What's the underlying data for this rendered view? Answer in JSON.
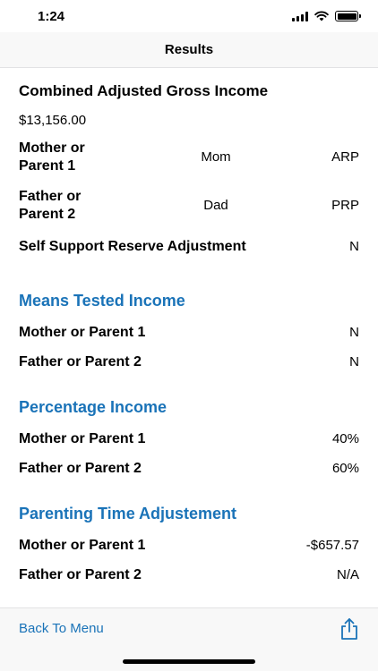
{
  "status": {
    "time": "1:24"
  },
  "nav": {
    "title": "Results"
  },
  "combined": {
    "title": "Combined Adjusted Gross Income",
    "amount": "$13,156.00"
  },
  "parents": [
    {
      "label": "Mother or Parent 1",
      "short": "Mom",
      "code": "ARP"
    },
    {
      "label": "Father or Parent 2",
      "short": "Dad",
      "code": "PRP"
    }
  ],
  "ssr": {
    "label": "Self Support Reserve Adjustment",
    "value": "N"
  },
  "means_tested": {
    "title": "Means Tested Income",
    "rows": [
      {
        "label": "Mother or Parent 1",
        "value": "N"
      },
      {
        "label": "Father or Parent 2",
        "value": "N"
      }
    ]
  },
  "percentage": {
    "title": "Percentage Income",
    "rows": [
      {
        "label": "Mother or Parent 1",
        "value": "40%"
      },
      {
        "label": "Father or Parent 2",
        "value": "60%"
      }
    ]
  },
  "parenting_time": {
    "title": "Parenting Time Adjustement",
    "rows": [
      {
        "label": "Mother or Parent 1",
        "value": "-$657.57"
      },
      {
        "label": "Father or Parent 2",
        "value": "N/A"
      }
    ]
  },
  "toolbar": {
    "back_label": "Back To Menu",
    "share_icon": "share-icon"
  },
  "colors": {
    "accent": "#1a73b8"
  }
}
